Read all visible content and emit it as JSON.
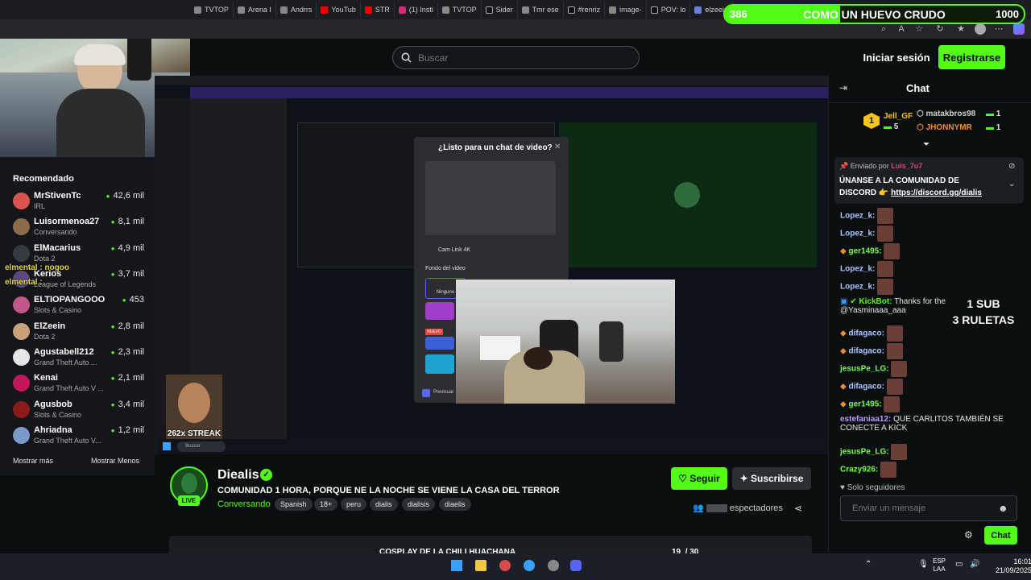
{
  "browser": {
    "tabs": [
      "TVTOP",
      "Arena I",
      "Andrrs",
      "YouTub",
      "STR",
      "(1) Insti",
      "TVTOP",
      "Sider",
      "Tmr ese",
      "#renriz",
      "image-",
      "POV: lo",
      "elzeein"
    ]
  },
  "top_goal": {
    "left": "386",
    "label": "COMO UN HUEVO CRUDO",
    "right": "1000",
    "progress": 0.386
  },
  "header": {
    "search_placeholder": "Buscar",
    "login_label": "Iniciar sesión",
    "register_label": "Registrarse"
  },
  "sidebar": {
    "title": "Recomendado",
    "items": [
      {
        "name": "MrStivenTc",
        "category": "IRL",
        "viewers": "42,6 mil",
        "color": "#d9534f"
      },
      {
        "name": "Luisormenoa27",
        "category": "Conversando",
        "viewers": "8,1 mil",
        "color": "#8b6b4a"
      },
      {
        "name": "ElMacarius",
        "category": "Dota 2",
        "viewers": "4,9 mil",
        "color": "#333a40"
      },
      {
        "name": "Kerios",
        "category": "League of Legends",
        "viewers": "3,7 mil",
        "color": "#5a4a7a"
      },
      {
        "name": "ELTIOPANGOOO",
        "category": "Slots & Casino",
        "viewers": "453",
        "color": "#c2558a"
      },
      {
        "name": "ElZeein",
        "category": "Dota 2",
        "viewers": "2,8 mil",
        "color": "#c9a27a"
      },
      {
        "name": "Agustabell212",
        "category": "Grand Theft Auto ...",
        "viewers": "2,3 mil",
        "color": "#e6e6e6"
      },
      {
        "name": "Kenai",
        "category": "Grand Theft Auto V ...",
        "viewers": "2,1 mil",
        "color": "#c2185b"
      },
      {
        "name": "Agusbob",
        "category": "Slots & Casino",
        "viewers": "3,4 mil",
        "color": "#8b1a1a"
      },
      {
        "name": "Ahriadna",
        "category": "Grand Theft Auto V...",
        "viewers": "1,2 mil",
        "color": "#7a9ac9"
      }
    ],
    "show_more": "Mostrar más",
    "show_less": "Mostrar Menos"
  },
  "overlay": {
    "mental_line1": "elmental : nogoo",
    "mental_line2": "elmental :",
    "streak": "262x STREAK",
    "modal_title": "¿Listo para un chat de video?",
    "cam_label": "Cam Link 4K",
    "bg_label": "Fondo del video",
    "none_label": "Ninguno",
    "new_label": "NUEVO",
    "preview_label": "Previsual"
  },
  "streamer": {
    "name": "Diealis",
    "title": "COMUNIDAD 1 HORA, PORQUE NE LA NOCHE SE VIENE LA CASA DEL TERROR",
    "category": "Conversando",
    "tags": [
      "Spanish",
      "18+",
      "peru",
      "dialis",
      "dialisis",
      "diaelis"
    ],
    "live_label": "LIVE",
    "follow_label": "Seguir",
    "subscribe_label": "Suscribirse",
    "viewers_label": "espectadores"
  },
  "goal": {
    "label": "COSPLAY DE LA CHILI HUACHANA",
    "current": "19",
    "total": "/ 30",
    "progress": 0.633
  },
  "chat": {
    "title": "Chat",
    "leaderboard": [
      {
        "rank": "1",
        "name": "Jell_GF",
        "count": "5",
        "color": "#f5c518"
      },
      {
        "name": "matakbros98",
        "count": "1",
        "color": "#d0d0d0"
      },
      {
        "name": "JHONNYMR",
        "count": "1",
        "color": "#f28b2c"
      }
    ],
    "pinned": {
      "sent_by": "Enviado por",
      "user": "Luis_7u7",
      "text_line1": "ÚNANSE A LA COMUNIDAD DE",
      "text_line2": "DISCORD 👉",
      "link": "https://discord.gg/dialis"
    },
    "messages": [
      {
        "user": "Lopez_k:",
        "color": "#a8c6ff",
        "text": ""
      },
      {
        "user": "Lopez_k:",
        "color": "#a8c6ff",
        "text": ""
      },
      {
        "user": "ger1495:",
        "color": "#75fd46",
        "text": ""
      },
      {
        "user": "Lopez_k:",
        "color": "#a8c6ff",
        "text": ""
      },
      {
        "user": "Lopez_k:",
        "color": "#a8c6ff",
        "text": ""
      },
      {
        "user": "KickBot:",
        "color": "#53fc18",
        "text": "Thanks for the",
        "text2": "@Yasminaaa_aaa"
      },
      {
        "user": "difagaco:",
        "color": "#a8c6ff",
        "text": ""
      },
      {
        "user": "difagaco:",
        "color": "#a8c6ff",
        "text": ""
      },
      {
        "user": "jesusPe_LG:",
        "color": "#75fd46",
        "text": ""
      },
      {
        "user": "difagaco:",
        "color": "#a8c6ff",
        "text": ""
      },
      {
        "user": "ger1495:",
        "color": "#75fd46",
        "text": ""
      },
      {
        "user": "estefaniaa12:",
        "color": "#b99cff",
        "text": "QUE CARLITOS TAMBIÉN SE",
        "text2": "CONECTE A KICK"
      },
      {
        "user": "jesusPe_LG:",
        "color": "#75fd46",
        "text": ""
      },
      {
        "user": "Crazy926:",
        "color": "#75fd46",
        "text": ""
      }
    ],
    "followers_only": "Solo seguidores",
    "input_placeholder": "Enviar un mensaje",
    "send_label": "Chat"
  },
  "sub_overlay": {
    "line1": "1 SUB",
    "line2": "3 RULETAS"
  },
  "os": {
    "lang1": "ESP",
    "lang2": "LAA",
    "time": "16:01",
    "date": "21/09/2025"
  }
}
